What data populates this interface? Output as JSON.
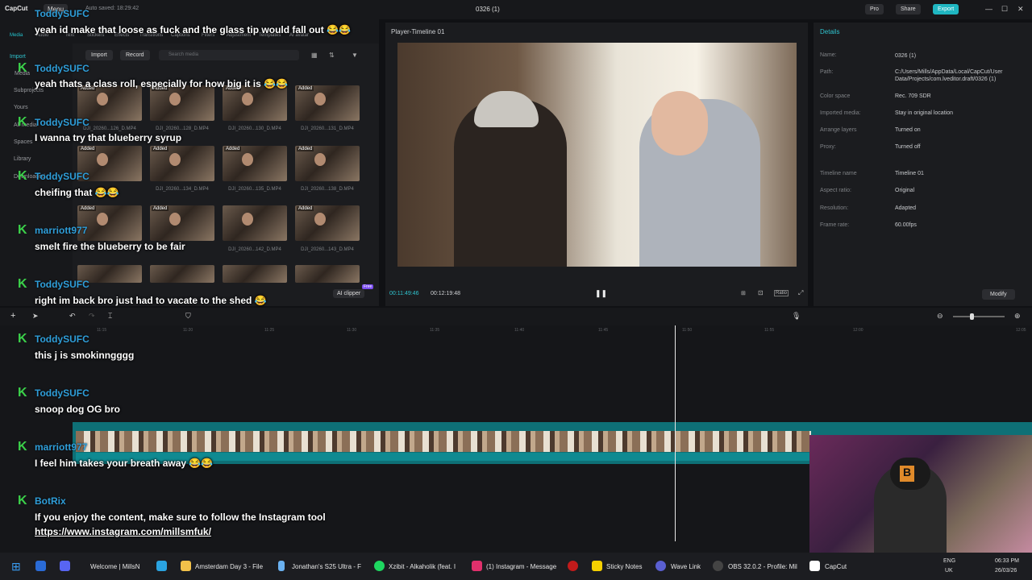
{
  "app": {
    "logo": "CapCut",
    "menu": "Menu",
    "autosave": "Auto saved: 18:29:42",
    "doc_title": "0326 (1)",
    "pro": "Pro",
    "share": "Share",
    "export": "Export"
  },
  "tools": [
    "Media",
    "Audio",
    "Text",
    "Stickers",
    "Effects",
    "Transitions",
    "Captions",
    "Filters",
    "Adjustment",
    "Templates",
    "AI avatar"
  ],
  "leftnav": [
    "Import",
    "Media",
    "AI",
    "Subprojects",
    "Yours",
    "All media",
    "Spaces",
    "Library",
    "Downloaded"
  ],
  "media": {
    "import": "Import",
    "record": "Record",
    "search_placeholder": "Search media",
    "added": "Added",
    "thumbs": [
      "DJI_20260...126_D.MP4",
      "DJI_20260...128_D.MP4",
      "DJI_20260...130_D.MP4",
      "DJI_20260...131_D.MP4",
      "DJI_20260...134_D.MP4",
      "DJI_20260...135_D.MP4",
      "DJI_20260...138_D.MP4",
      "DJI_20260...142_D.MP4",
      "DJI_20260...143_D.MP4"
    ],
    "ai_clipper": "AI clipper",
    "free": "Free"
  },
  "player": {
    "title": "Player-Timeline 01",
    "current": "00:11:49:46",
    "total": "00:12:19:48",
    "ratio": "Ratio"
  },
  "details": {
    "title": "Details",
    "rows": [
      {
        "k": "Name:",
        "v": "0326 (1)"
      },
      {
        "k": "Path:",
        "v": "C:/Users/Mills/AppData/Local/CapCut/User Data/Projects/com.lveditor.draft/0326 (1)"
      },
      {
        "k": "Color space",
        "v": "Rec. 709 SDR"
      },
      {
        "k": "Imported media:",
        "v": "Stay in original location"
      },
      {
        "k": "Arrange layers",
        "v": "Turned on"
      },
      {
        "k": "Proxy:",
        "v": "Turned off"
      },
      {
        "k": "Timeline name",
        "v": "Timeline 01"
      },
      {
        "k": "Aspect ratio:",
        "v": "Original"
      },
      {
        "k": "Resolution:",
        "v": "Adapted"
      },
      {
        "k": "Frame rate:",
        "v": "60.00fps"
      }
    ],
    "modify": "Modify"
  },
  "ruler": [
    "11:15",
    "11:20",
    "11:25",
    "11:30",
    "11:35",
    "11:40",
    "11:45",
    "11:50",
    "11:55",
    "12:00",
    "12:05"
  ],
  "chat": [
    {
      "user": "ToddySUFC",
      "msg": "yeah id make that loose as fuck and the glass tip would fall out 😂😂"
    },
    {
      "user": "ToddySUFC",
      "msg": "yeah thats a class roll, especially for how big it is 😂😂"
    },
    {
      "user": "ToddySUFC",
      "msg": "I wanna try that blueberry syrup"
    },
    {
      "user": "ToddySUFC",
      "msg": "cheifing that 😂😂"
    },
    {
      "user": "marriott977",
      "msg": "smelt fire the blueberry to be fair"
    },
    {
      "user": "ToddySUFC",
      "msg": "right im back bro just had to vacate to the shed 😂"
    },
    {
      "user": "ToddySUFC",
      "msg": "this j is smokinngggg"
    },
    {
      "user": "ToddySUFC",
      "msg": "snoop dog OG bro"
    },
    {
      "user": "marriott977",
      "msg": "I feel him takes your breath away 😂😂"
    },
    {
      "user": "BotRix",
      "msg": "If you enjoy the content, make sure to follow the Instagram tool"
    }
  ],
  "chat_link": "https://www.instagram.com/millsmfuk/",
  "taskbar": {
    "items": [
      "Welcome | MillsN",
      "Amsterdam Day 3 - File",
      "Jonathan's S25 Ultra - F",
      "Xzibit - Alkaholik (feat. I",
      "(1) Instagram - Message",
      "Sticky Notes",
      "Wave Link",
      "OBS 32.0.2 - Profile: Mil",
      "CapCut"
    ],
    "lang": "ENG",
    "region": "UK",
    "time": "06:33 PM",
    "date": "26/03/26"
  },
  "colors": {
    "accent": "#1fb6c1",
    "kick": "#3bd14a",
    "chat_user": "#2f9ed9"
  }
}
